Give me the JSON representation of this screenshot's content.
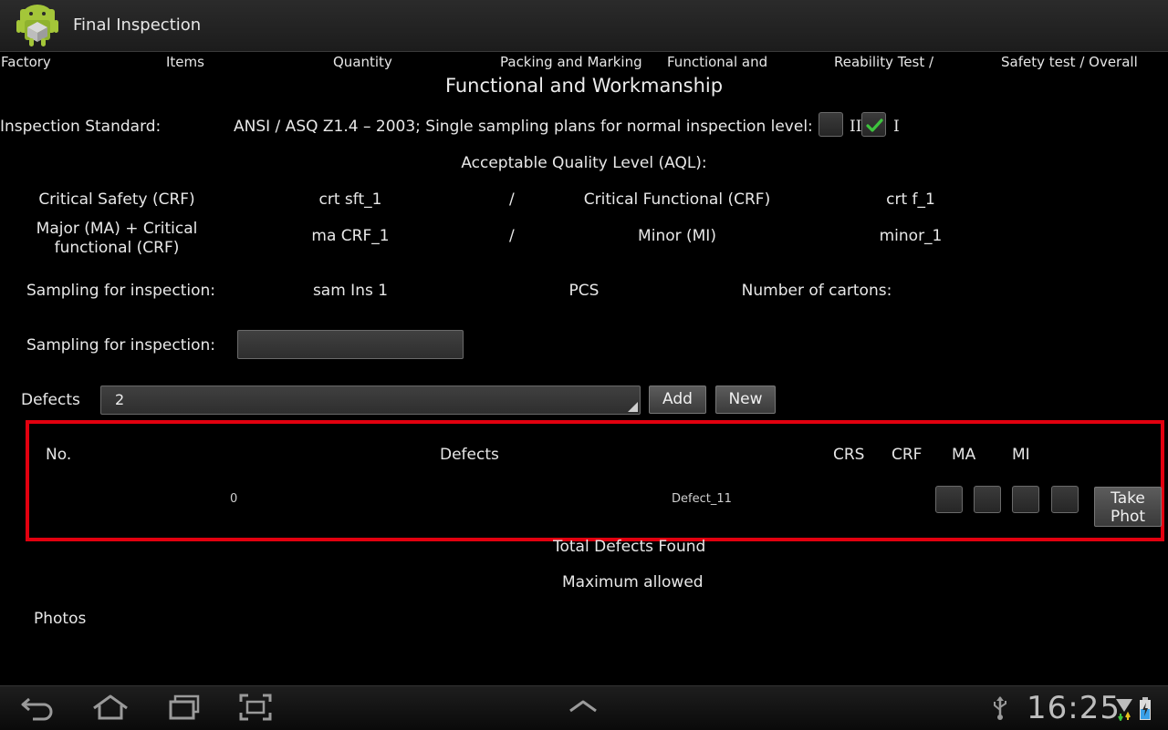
{
  "app": {
    "title": "Final Inspection"
  },
  "tabs": [
    {
      "label": "Factory"
    },
    {
      "label": "Items"
    },
    {
      "label": "Quantity"
    },
    {
      "label": "Packing and Marking"
    },
    {
      "label": "Functional and"
    },
    {
      "label": "Reability Test /"
    },
    {
      "label": "Safety test / Overall"
    }
  ],
  "section": {
    "title": "Functional and Workmanship"
  },
  "inspection_standard": {
    "label": "Inspection Standard:",
    "text": "ANSI / ASQ Z1.4 – 2003; Single sampling plans for normal inspection level:",
    "level_options": [
      {
        "label": "II",
        "checked": false
      },
      {
        "label": "I",
        "checked": true
      }
    ]
  },
  "aql": {
    "title": "Acceptable Quality Level (AQL):",
    "row1": {
      "label_a": "Critical Safety (CRF)",
      "value_a": "crt sft_1",
      "sep": "/",
      "label_b": "Critical Functional (CRF)",
      "value_b": "crt f_1"
    },
    "row2": {
      "label_a": "Major (MA) + Critical functional (CRF)",
      "value_a": "ma CRF_1",
      "sep": "/",
      "label_b": "Minor (MI)",
      "value_b": "minor_1"
    }
  },
  "sampling": {
    "label": "Sampling for inspection:",
    "value": "sam Ins 1",
    "unit": "PCS",
    "cartons_label": "Number of cartons:",
    "label2": "Sampling for inspection:",
    "input_value": ""
  },
  "defects_bar": {
    "label": "Defects",
    "selected": "2",
    "add_label": "Add",
    "new_label": "New"
  },
  "table": {
    "headers": {
      "no": "No.",
      "defects": "Defects",
      "crs": "CRS",
      "crf": "CRF",
      "ma": "MA",
      "mi": "MI"
    },
    "rows": [
      {
        "no": "0",
        "defect": "Defect_11",
        "crs": false,
        "crf": false,
        "ma": false,
        "mi": false,
        "photo_label": "Take Phot"
      }
    ]
  },
  "summary": {
    "total_label": "Total Defects Found",
    "max_label": "Maximum allowed",
    "photos_label": "Photos"
  },
  "status": {
    "time": "16:25"
  },
  "colors": {
    "highlight": "#e2000f",
    "check": "#3ec43e",
    "android_green": "#a4c639"
  }
}
